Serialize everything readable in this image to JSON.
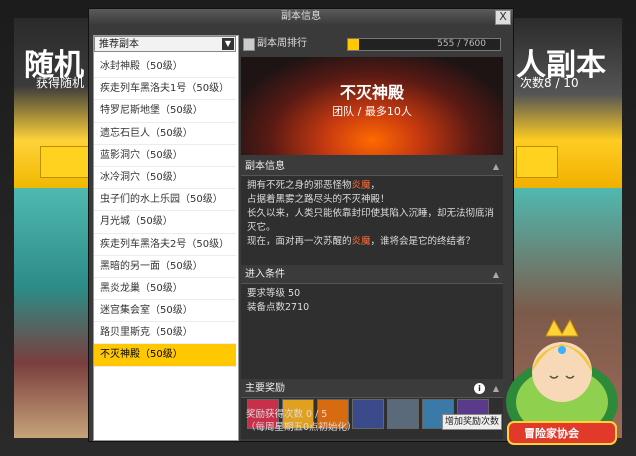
{
  "background": {
    "left_title": "随机",
    "left_subtitle": "获得随机",
    "right_title": "人副本",
    "right_subtitle": "次数8 / 10"
  },
  "window": {
    "title": "副本信息",
    "close_label": "X"
  },
  "list_panel": {
    "select_value": "推荐副本",
    "items": [
      "冰封神殿（50级）",
      "疾走列车黑洛夫1号（50级）",
      "特罗尼斯地堡（50级）",
      "遗忘石巨人（50级）",
      "蓝影洞穴（50级）",
      "冰冷洞穴（50级）",
      "虫子们的水上乐园（50级）",
      "月光城（50级）",
      "疾走列车黑洛夫2号（50级）",
      "黑暗的另一面（50级）",
      "黑炎龙巢（50级）",
      "迷宫集会室（50级）",
      "路贝里斯克（50级）",
      "不灭神殿（50级）"
    ],
    "selected_index": 13
  },
  "ranking": {
    "label": "副本周排行",
    "progress_text": "555 / 7600",
    "progress_value": 555,
    "progress_max": 7600
  },
  "banner": {
    "title": "不灭神殿",
    "subtitle": "团队 / 最多10人"
  },
  "dungeon_info": {
    "header": "副本信息",
    "line1_a": "拥有不死之身的邪恶怪物",
    "line1_fire": "炎魔",
    "line1_b": "，",
    "line2": "占据着黑雾之路尽头的不灭神殿！",
    "line3": "长久以来，人类只能依靠封印使其陷入沉睡，却无法彻底消灭它。",
    "line4_a": "现在，面对再一次苏醒的",
    "line4_fire": "炎魔",
    "line4_b": "，谁将会是它的终结者？"
  },
  "entry": {
    "header": "进入条件",
    "level": "要求等级 50",
    "equip": "装备点数2710"
  },
  "rewards": {
    "header": "主要奖励",
    "count": "奖励获得次数 0 / 5",
    "note": "（每周星期五0点初始化）",
    "bonus_button": "增加奖励次数",
    "items": [
      "star-badge-icon",
      "gold-coin-icon",
      "orange-gem-icon",
      "blue-orb-icon",
      "ice-staff-icon",
      "scroll-map-icon",
      "purple-cape-icon"
    ]
  },
  "mascot": {
    "banner_text": "冒险家协会"
  },
  "colors": {
    "accent": "#ffc800",
    "fire_text": "#ff6a3a"
  }
}
